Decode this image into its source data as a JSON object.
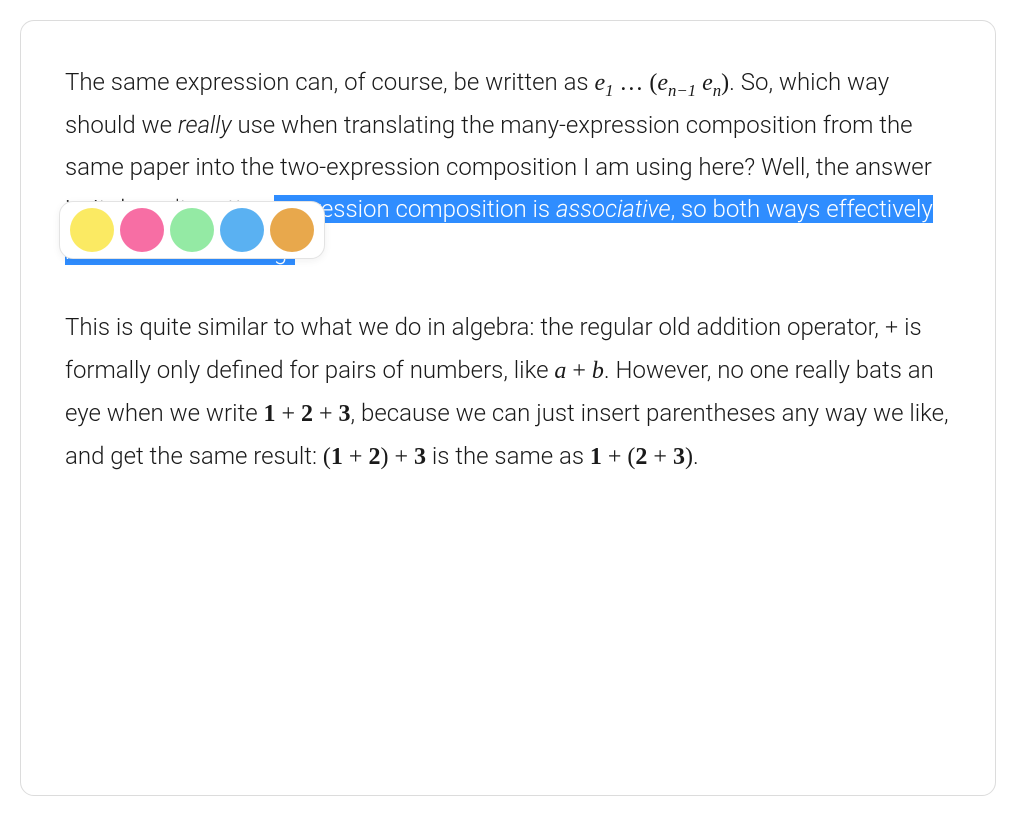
{
  "para1": {
    "t1": "The same expression can, of course, be written as ",
    "expr1_a": "e",
    "expr1_sub1": "1",
    "expr1_dots": " … ",
    "expr1_lp": "(",
    "expr1_b": "e",
    "expr1_sub2": "n−1",
    "expr1_sp": " ",
    "expr1_c": "e",
    "expr1_sub3": "n",
    "expr1_rp": ")",
    "t2": ". So, which way should we ",
    "t2_really": "really",
    "t2b": " use when translating the many-expression composition from the same paper into the two-expression composition I am using here? Well, the answer is, it doesn't matter; ",
    "hl_a": "expression composition is ",
    "hl_assoc": "associative",
    "hl_b": ", so both ways effectively mean the same thing."
  },
  "para2": {
    "t1": "This is quite similar to what we do in algebra: the regular old addition operator, ",
    "plus1": "+",
    "t2": " is formally only defined for pairs of numbers, like ",
    "a": "a",
    "plus2": " + ",
    "b": "b",
    "t3": ". However, no one really bats an eye when we write ",
    "n1": "1",
    "plus3": " + ",
    "n2": "2",
    "plus4": " + ",
    "n3": "3",
    "t4": ", because we can just insert parentheses any way we like, and get the same result: ",
    "lp1": "(",
    "n4": "1",
    "plus5": " + ",
    "n5": "2",
    "rp1": ")",
    "plus6": " + ",
    "n6": "3",
    "t5": " is the same as ",
    "n7": "1",
    "plus7": " + ",
    "lp2": "(",
    "n8": "2",
    "plus8": " + ",
    "n9": "3",
    "rp2": ")",
    "t6": "."
  },
  "palette": {
    "colors": {
      "yellow": "#fbea63",
      "pink": "#f76ea4",
      "green": "#94eaa4",
      "blue": "#5ab1f2",
      "orange": "#e8a84c"
    }
  }
}
